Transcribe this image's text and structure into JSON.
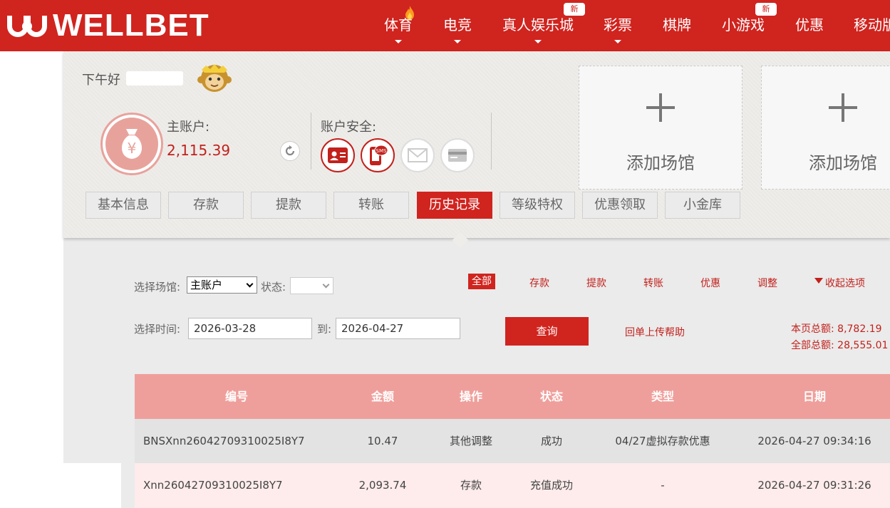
{
  "brand": {
    "logo_text": "WELLBET"
  },
  "nav": {
    "items": [
      {
        "label": "体育",
        "has_caret": true
      },
      {
        "label": "电竞",
        "has_caret": true
      },
      {
        "label": "真人娱乐城",
        "has_caret": true,
        "badge": "新"
      },
      {
        "label": "彩票",
        "has_caret": true
      },
      {
        "label": "棋牌"
      },
      {
        "label": "小游戏",
        "badge": "新"
      },
      {
        "label": "优惠"
      },
      {
        "label": "移动版"
      }
    ]
  },
  "profile": {
    "greeting": "下午好",
    "main_account_label": "主账户:",
    "main_account_value": "2,115.39",
    "security_label": "账户安全:",
    "security_icons": [
      "id-card-icon",
      "sms-phone-icon",
      "email-icon",
      "bank-card-icon"
    ]
  },
  "venues": [
    {
      "label": "添加场馆"
    },
    {
      "label": "添加场馆"
    }
  ],
  "tabs": [
    "基本信息",
    "存款",
    "提款",
    "转账",
    "历史记录",
    "等级特权",
    "优惠领取",
    "小金库"
  ],
  "active_tab": "历史记录",
  "filters": {
    "venue_label": "选择场馆:",
    "venue_value": "主账户",
    "status_label": "状态:",
    "status_value": "",
    "time_label": "选择时间:",
    "date_from": "2026-03-28",
    "to_label": "到:",
    "date_to": "2026-04-27",
    "type_links": [
      "全部",
      "存款",
      "提款",
      "转账",
      "优惠",
      "调整"
    ],
    "active_type": "全部",
    "collapse_label": "收起选项",
    "query_button": "查询",
    "help_link": "回单上传帮助",
    "page_total_label": "本页总额:",
    "page_total_value": "8,782.19",
    "all_total_label": "全部总额:",
    "all_total_value": "28,555.01"
  },
  "table": {
    "columns": [
      "编号",
      "金额",
      "操作",
      "状态",
      "类型",
      "日期"
    ],
    "rows": [
      {
        "id": "BNSXnn26042709310025I8Y7",
        "amount": "10.47",
        "op": "其他调整",
        "status": "成功",
        "type": "04/27虚拟存款优惠",
        "date": "2026-04-27 09:34:16"
      },
      {
        "id": "Xnn26042709310025I8Y7",
        "amount": "2,093.74",
        "op": "存款",
        "status": "充值成功",
        "type": "-",
        "date": "2026-04-27 09:31:26"
      }
    ]
  },
  "colors": {
    "brand_red": "#d0241f",
    "table_header": "#ef9f9b",
    "accent_text": "#c2211c"
  }
}
